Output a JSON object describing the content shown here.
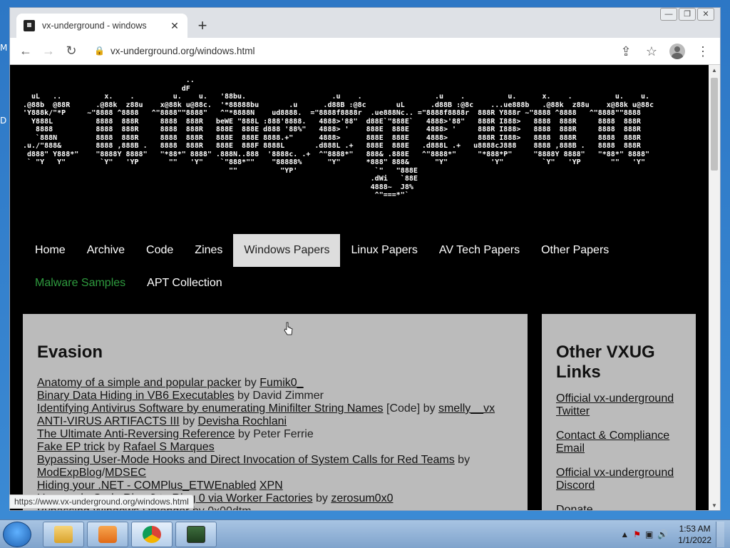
{
  "desktop": {
    "left_chars": [
      "M",
      "D"
    ]
  },
  "browser": {
    "tab_title": "vx-underground - windows",
    "tab_close": "✕",
    "new_tab": "+",
    "url": "vx-underground.org/windows.html",
    "window_controls": [
      "—",
      "❐",
      "✕"
    ],
    "nav_back": "←",
    "nav_forward": "→",
    "nav_reload": "↻",
    "lock": "🔒",
    "share": "⇪",
    "star": "☆",
    "menu": "⋮"
  },
  "page": {
    "ascii_art": "                                      ..\n                                     dF\n  uL   ..          x.    .         u.    u.   '88bu.                    .u    .                 .u    .          u.      x.    .          u.    u.\n.@88b  @88R      .@88k  z88u    x@88k u@88c.  '*88888bu       .u      .d88B :@8c       uL      .d88B :@8c    ...ue888b   .@88k  z88u    x@88k u@88c\n'Y888k/\"*P     ~\"8888 ^8888   ^\"8888\"\"8888\"   ^\"*8888N    ud8888.  =\"8888f8888r  .ue888Nc.. =\"8888f8888r  888R Y888r ~\"8888 ^8888   ^\"8888\"\"8888\n  Y888L          8888  888R     8888  888R   beWE \"888L :888'8888.   4888>'88\"  d88E`\"888E`   4888>'88\"   888R I888>   8888  888R     8888  888R\n   8888          8888  888R     8888  888R   888E  888E d888 '88%\"   4888> '    888E  888E    4888> '     888R I888>   8888  888R     8888  888R\n   `888N         8888  888R     8888  888R   888E  888E 8888.+\"      4888>      888E  888E    4888>       888R I888>   8888  888R     8888  888R\n.u./\"888&        8888 ,888B .   8888  888R   888E  888F 8888L       .d888L .+   888E  888E   .d888L .+   u8888cJ888    8888 ,888B .   8888  888R\n d888\" Y888*\"    \"8888Y 8888\"   \"*88*\" 8888\" .888N..888  '8888c. .+  ^\"8888*\"   888& .888E   ^\"8888*\"     \"*888*P\"     \"8888Y 8888\"   \"*88*\" 8888\"\n ` \"Y   Y\"        `Y\"   'YP       \"\"   'Y\"    `\"888*\"\"    \"88888%      \"Y\"      *888\" 888&      \"Y\"          'Y\"         `Y\"   'YP       \"\"   'Y\"\n                                                \"\"          \"YP'                  `\"   \"888E\n                                                                                 .dWi   `88E\n                                                                                 4888~  J8%\n                                                                                  ^\"===*\"`",
    "nav_row1": [
      "Home",
      "Archive",
      "Code",
      "Zines",
      "Windows Papers",
      "Linux Papers",
      "AV Tech Papers",
      "Other Papers"
    ],
    "nav_row2": [
      "Malware Samples",
      "APT Collection"
    ],
    "active_nav": "Windows Papers",
    "main_heading": "Evasion",
    "papers": [
      {
        "title": "Anatomy of a simple and popular packer",
        "by": " by ",
        "author": "Fumik0_",
        "author_link": true
      },
      {
        "title": "Binary Data Hiding in VB6 Executables",
        "by": " by ",
        "author": "David Zimmer",
        "author_link": false
      },
      {
        "title": "Identifying Antivirus Software by enumerating Minifilter String Names",
        "extra": " [Code]",
        "by": " by ",
        "author": "smelly__vx",
        "author_link": true
      },
      {
        "title": "ANTI-VIRUS ARTIFACTS III",
        "by": " by ",
        "author": "Devisha Rochlani",
        "author_link": true
      },
      {
        "title": "The Ultimate Anti-Reversing Reference",
        "by": " by ",
        "author": "Peter Ferrie",
        "author_link": false
      },
      {
        "title": "Fake EP trick",
        "by": " by ",
        "author": "Rafael S Marques",
        "author_link": true
      },
      {
        "title": "Bypassing User-Mode Hooks and Direct Invocation of System Calls for Red Teams",
        "by": " by ",
        "author": "",
        "author_link": false
      },
      {
        "title": "ModExpBlog",
        "extra": "/",
        "extra2": "MDSEC",
        "by": "",
        "author": "",
        "author_link": false
      },
      {
        "title": "Hiding your .NET - COMPlus_ETWEnabled",
        "by": " ",
        "author": "XPN",
        "author_link": true
      },
      {
        "title": "Usermode Code Ring 3 to Ring 0 via Worker Factories",
        "by": " by ",
        "author": "zerosum0x0",
        "author_link": true
      },
      {
        "title": "Bypassing Windows Defender",
        "by": " by ",
        "author": "0x00dtm",
        "author_link": false
      }
    ],
    "side_heading": "Other VXUG Links",
    "side_links": [
      "Official vx-underground Twitter",
      "Contact & Compliance Email",
      "Official vx-underground Discord",
      "Donate"
    ]
  },
  "status_url": "https://www.vx-underground.org/windows.html",
  "taskbar": {
    "apps": [
      "explorer-icon",
      "media-player-icon",
      "chrome-icon",
      "task-manager-icon"
    ],
    "tray": [
      "▲",
      "⚑",
      "▣",
      "🔊"
    ],
    "time": "1:53 AM",
    "date": "1/1/2022"
  }
}
